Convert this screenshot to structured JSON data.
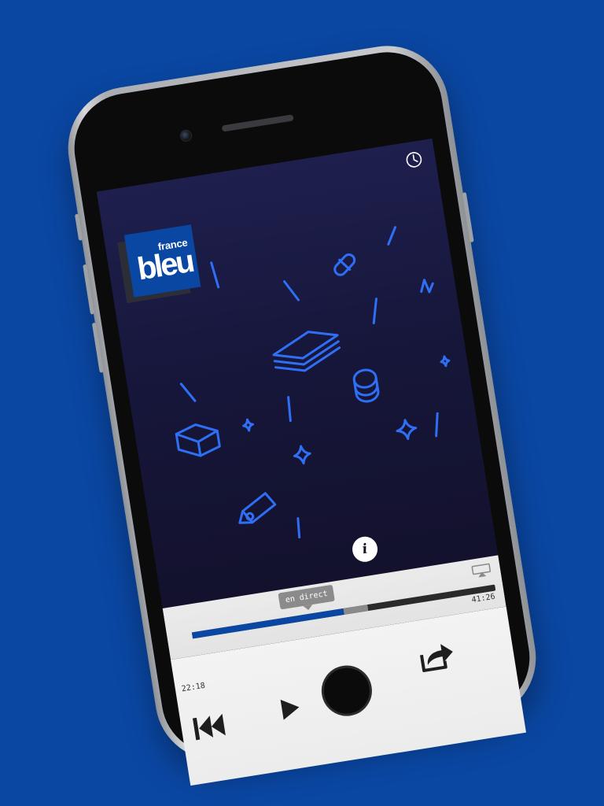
{
  "colors": {
    "background": "#0a47a3",
    "accent": "#0a47a3",
    "doodle": "#2f6ff5",
    "screen_top": "#1e1f4d",
    "screen_bottom": "#121029"
  },
  "app": {
    "logo_small": "france",
    "logo_big": "bleu"
  },
  "header": {
    "timer_icon": "clock-icon"
  },
  "player": {
    "info_label": "i",
    "live_label": "en direct",
    "time_start": "22:18",
    "time_end": "41:26",
    "progress_fraction": 0.5,
    "buffer_fraction": 0.58,
    "airplay_icon": "airplay-icon"
  },
  "controls": {
    "rewind_icon": "skip-back-icon",
    "play_icon": "play-icon",
    "volume_icon": "speaker-icon",
    "share_icon": "share-icon"
  }
}
